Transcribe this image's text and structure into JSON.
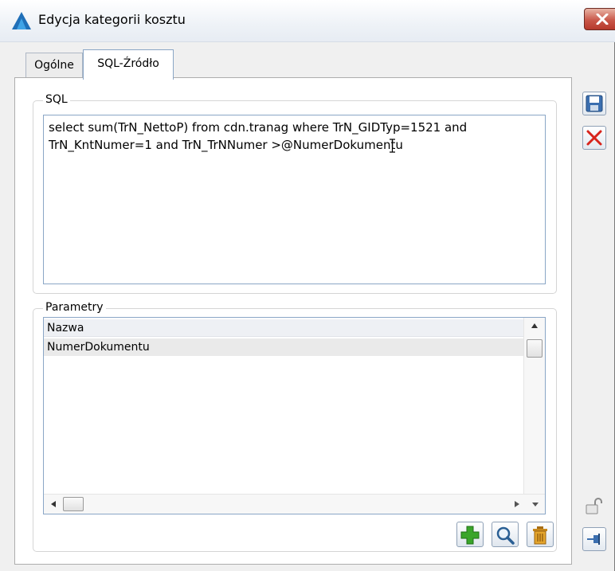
{
  "window": {
    "title": "Edycja kategorii kosztu"
  },
  "tabs": [
    {
      "label": "Ogólne",
      "active": false
    },
    {
      "label": "SQL-Źródło",
      "active": true
    }
  ],
  "sql_group": {
    "legend": "SQL",
    "query": "select sum(TrN_NettoP) from cdn.tranag where TrN_GIDTyp=1521 and TrN_KntNumer=1 and TrN_TrNNumer >@NumerDokumentu"
  },
  "params_group": {
    "legend": "Parametry",
    "column_header": "Nazwa",
    "rows": [
      "NumerDokumentu"
    ]
  },
  "icons": {
    "app": "app-logo-icon",
    "close": "close-icon",
    "save": "save-icon",
    "cancel": "cancel-icon",
    "lock": "lock-icon",
    "pin": "pin-icon",
    "add": "add-icon",
    "search": "search-icon",
    "delete": "delete-icon"
  },
  "colors": {
    "accent": "#8aa6c6",
    "close_red": "#c9584a",
    "add_green": "#3aa52a",
    "cancel_red": "#d8241c"
  }
}
